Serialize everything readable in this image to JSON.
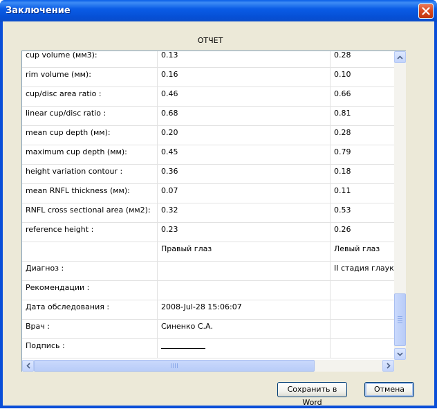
{
  "window": {
    "title": "Заключение",
    "colors": {
      "titlebar": "#0a5ce6",
      "client": "#ece9d8",
      "close": "#d7481f"
    }
  },
  "report": {
    "heading": "ОТЧЕТ",
    "rows": [
      {
        "label": "cup volume (мм3):",
        "right": "0.13",
        "left": "0.28"
      },
      {
        "label": "rim volume (мм):",
        "right": "0.16",
        "left": "0.10"
      },
      {
        "label": "cup/disc area ratio :",
        "right": "0.46",
        "left": "0.66"
      },
      {
        "label": "linear cup/disc ratio :",
        "right": "0.68",
        "left": "0.81"
      },
      {
        "label": "mean cup depth (мм):",
        "right": "0.20",
        "left": "0.28"
      },
      {
        "label": "maximum cup depth (мм):",
        "right": "0.45",
        "left": "0.79"
      },
      {
        "label": "height variation contour :",
        "right": "0.36",
        "left": "0.18"
      },
      {
        "label": "mean RNFL thickness (мм):",
        "right": "0.07",
        "left": "0.11"
      },
      {
        "label": "RNFL cross sectional area (мм2):",
        "right": "0.32",
        "left": "0.53"
      },
      {
        "label": "reference height :",
        "right": "0.23",
        "left": "0.26"
      },
      {
        "label": "",
        "right": "Правый глаз",
        "left": "Левый глаз"
      },
      {
        "label": "Диагноз :",
        "right": "",
        "left": "II стадия глаукомы"
      },
      {
        "label": "Рекомендации :",
        "right": "",
        "left": ""
      },
      {
        "label": "Дата обследования :",
        "right": "2008-Jul-28 15:06:07",
        "left": ""
      },
      {
        "label": "Врач :",
        "right": "Синенко С.А.",
        "left": ""
      },
      {
        "label": "Подпись :",
        "right": "",
        "left": ""
      }
    ]
  },
  "buttons": {
    "save_word": "Сохранить в Word",
    "cancel": "Отмена"
  }
}
